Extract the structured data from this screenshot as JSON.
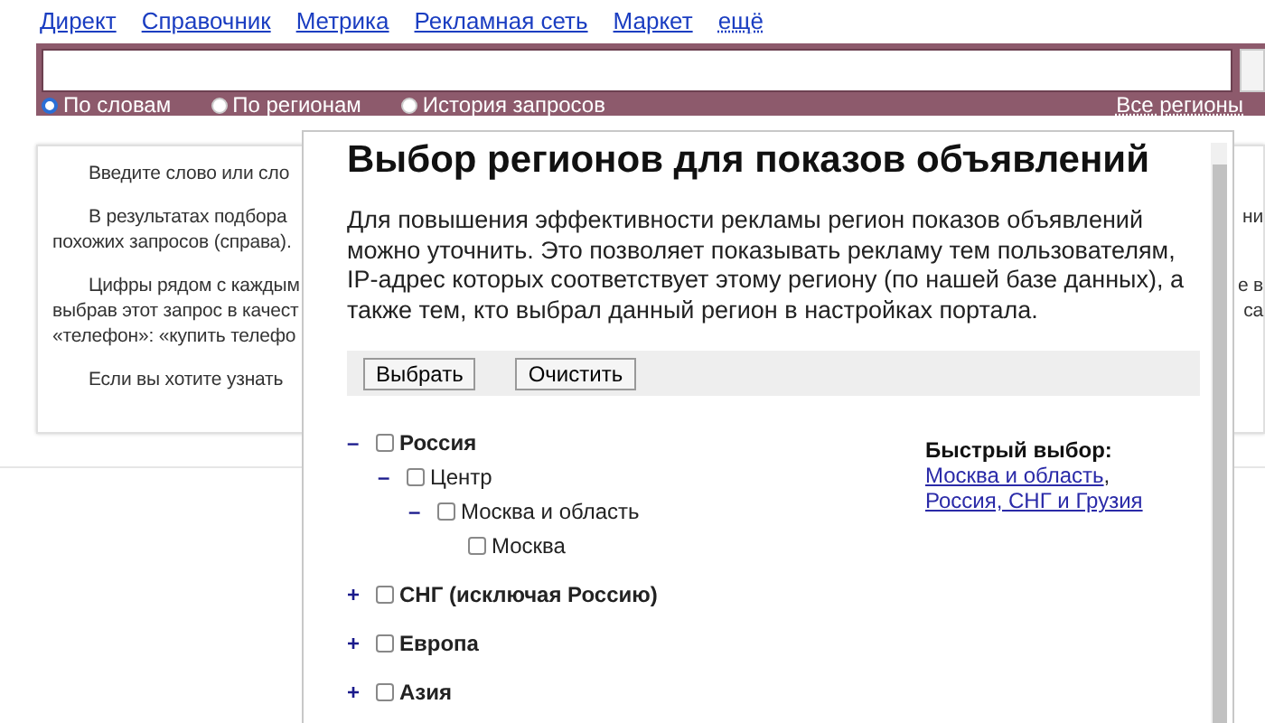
{
  "nav": [
    {
      "label": "Директ"
    },
    {
      "label": "Справочник"
    },
    {
      "label": "Метрика"
    },
    {
      "label": "Рекламная сеть"
    },
    {
      "label": "Маркет"
    },
    {
      "label": "ещё",
      "kind": "more"
    }
  ],
  "search": {
    "modes": [
      {
        "label": "По словам",
        "selected": true
      },
      {
        "label": "По регионам",
        "selected": false
      },
      {
        "label": "История запросов",
        "selected": false
      }
    ],
    "regions_link": "Все регионы"
  },
  "help_card": {
    "paragraphs": [
      {
        "lines": [
          "Введите слово или сло"
        ]
      },
      {
        "lines": [
          "В результатах подбора",
          "похожих запросов (справа)."
        ],
        "right": [
          "ни"
        ]
      },
      {
        "lines": [
          "Цифры рядом с каждым",
          "выбрав этот запрос в качест",
          "«телефон»: «купить телефо"
        ],
        "right": [
          "е в",
          "са"
        ]
      },
      {
        "lines": [
          "Если вы хотите узнать"
        ]
      }
    ]
  },
  "dialog": {
    "title": "Выбор регионов для показов объявлений",
    "description": "Для повышения эффективности рекламы регион показов объявлений можно уточнить. Это позволяет показывать рекламу тем пользователям, IP-адрес которых соответствует этому региону (по нашей базе данных), а также тем, кто выбрал данный регион в настройках портала.",
    "buttons": [
      "Выбрать",
      "Очистить"
    ],
    "regions": [
      {
        "label": "Россия",
        "toggle": "–",
        "checked": false,
        "children": [
          {
            "label": "Центр",
            "toggle": "–",
            "checked": false,
            "children": [
              {
                "label": "Москва и область",
                "toggle": "–",
                "checked": false,
                "children": [
                  {
                    "label": "Москва",
                    "checked": false
                  }
                ]
              }
            ]
          }
        ]
      },
      {
        "label": "СНГ (исключая Россию)",
        "toggle": "+",
        "checked": false
      },
      {
        "label": "Европа",
        "toggle": "+",
        "checked": false
      },
      {
        "label": "Азия",
        "toggle": "+",
        "checked": false
      }
    ],
    "quick_select": {
      "title": "Быстрый выбор:",
      "links": [
        "Москва и область",
        "Россия, СНГ и Грузия"
      ],
      "separator": ","
    }
  }
}
